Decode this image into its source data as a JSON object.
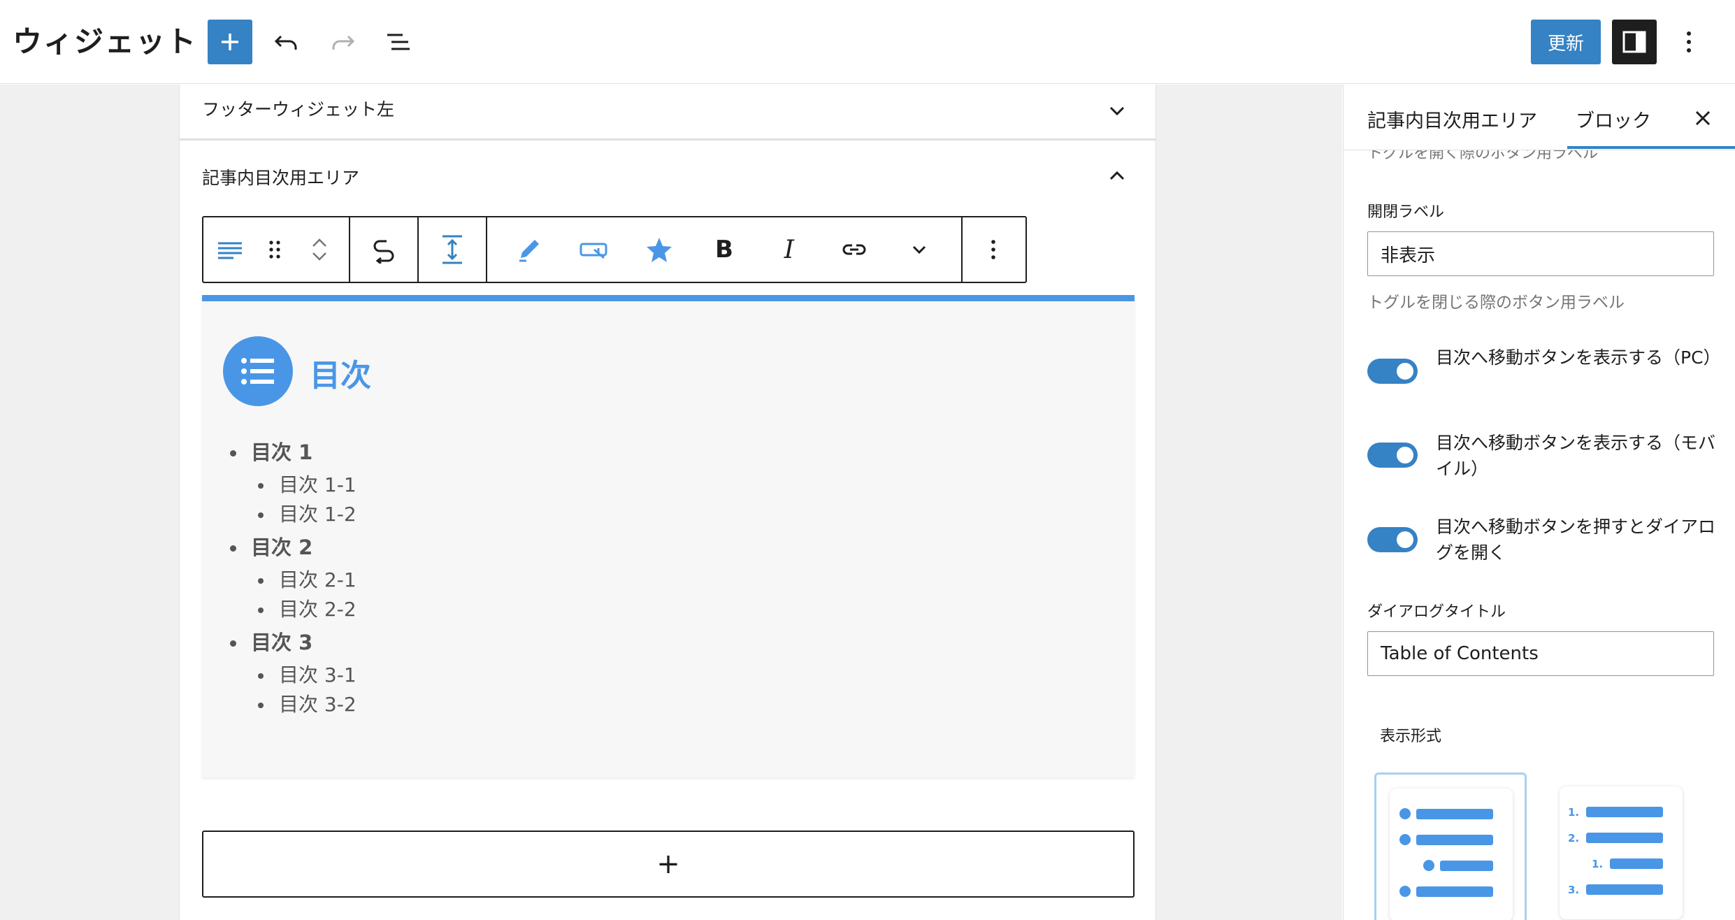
{
  "header": {
    "app_title": "ウィジェット",
    "update_label": "更新"
  },
  "widgets": {
    "footer_left": "フッターウィジェット左",
    "toc_area": "記事内目次用エリア"
  },
  "toc": {
    "title": "目次",
    "items": [
      {
        "label": "目次 1",
        "children": [
          "目次 1-1",
          "目次 1-2"
        ]
      },
      {
        "label": "目次 2",
        "children": [
          "目次 2-1",
          "目次 2-2"
        ]
      },
      {
        "label": "目次 3",
        "children": [
          "目次 3-1",
          "目次 3-2"
        ]
      }
    ]
  },
  "appender": {
    "label": "+"
  },
  "sidebar": {
    "tab_area": "記事内目次用エリア",
    "tab_block": "ブロック",
    "cut_help": "トグルを開く際のボタン用ラベル",
    "close_label_field": "開閉ラベル",
    "close_label_value": "非表示",
    "close_label_help": "トグルを閉じる際のボタン用ラベル",
    "toggle_pc": "目次へ移動ボタンを表示する（PC）",
    "toggle_mobile": "目次へ移動ボタンを表示する（モバイル）",
    "toggle_dialog": "目次へ移動ボタンを押すとダイアログを開く",
    "dialog_title_label": "ダイアログタイトル",
    "dialog_title_value": "Table of Contents",
    "display_format_label": "表示形式"
  },
  "numbered_preview": [
    "1.",
    "2.",
    "1.",
    "3."
  ],
  "colors": {
    "accent": "#3582c4",
    "toc_blue": "#4a96e6",
    "dark": "#1e1e1e"
  }
}
